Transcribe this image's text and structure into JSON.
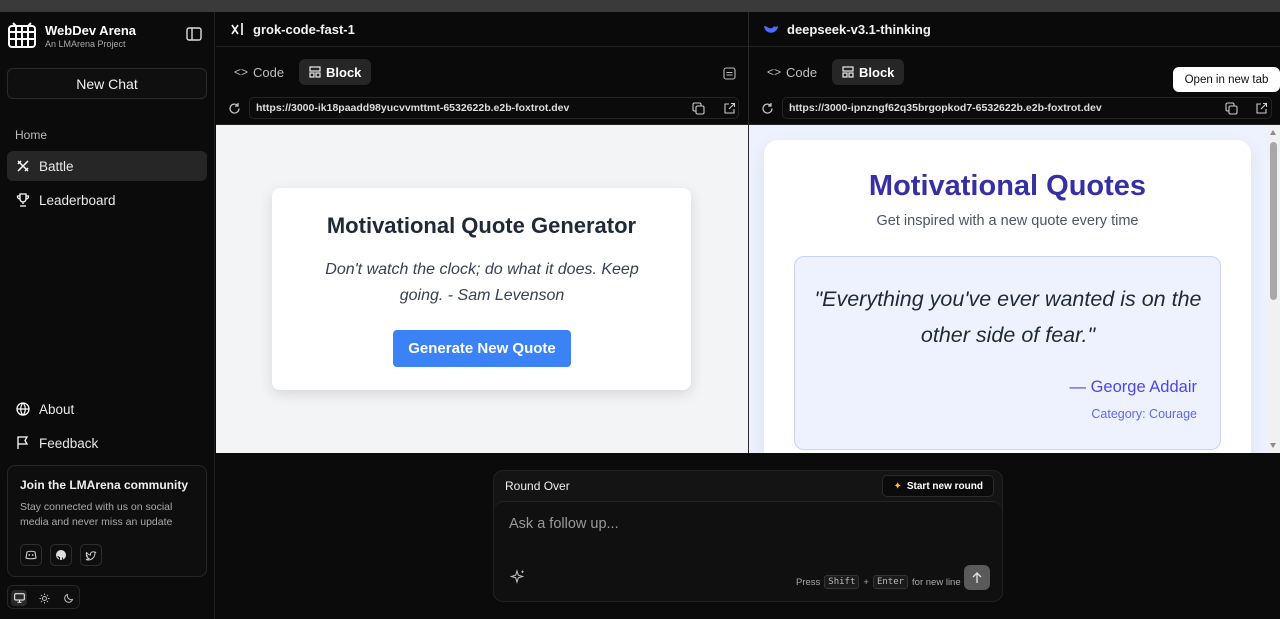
{
  "app": {
    "name": "WebDev Arena",
    "subtitle": "An LMArena Project"
  },
  "sidebar": {
    "new_chat": "New Chat",
    "home": "Home",
    "items": [
      {
        "label": "Battle",
        "icon": "swords-icon",
        "active": true
      },
      {
        "label": "Leaderboard",
        "icon": "trophy-icon",
        "active": false
      }
    ],
    "bottom_items": [
      {
        "label": "About",
        "icon": "globe-icon"
      },
      {
        "label": "Feedback",
        "icon": "flag-icon"
      }
    ],
    "community": {
      "title": "Join the LMArena community",
      "text": "Stay connected with us on social media and never miss an update"
    }
  },
  "left_pane": {
    "model": "grok-code-fast-1",
    "tabs": {
      "code": "Code",
      "block": "Block"
    },
    "url": "https://3000-ik18paadd98yucvvmttmt-6532622b.e2b-foxtrot.dev",
    "preview": {
      "title": "Motivational Quote Generator",
      "quote": "Don't watch the clock; do what it does. Keep going. - Sam Levenson",
      "button": "Generate New Quote"
    }
  },
  "right_pane": {
    "model": "deepseek-v3.1-thinking",
    "tabs": {
      "code": "Code",
      "block": "Block"
    },
    "url": "https://3000-ipnzngf62q35brgopkod7-6532622b.e2b-foxtrot.dev",
    "tooltip": "Open in new tab",
    "preview": {
      "title": "Motivational Quotes",
      "subtitle": "Get inspired with a new quote every time",
      "quote": "\"Everything you've ever wanted is on the other side of fear.\"",
      "author": "— George Addair",
      "category": "Category: Courage"
    }
  },
  "composer": {
    "status": "Round Over",
    "start_new": "Start new round",
    "placeholder": "Ask a follow up...",
    "hint_press": "Press",
    "hint_shift": "Shift",
    "hint_plus": "+",
    "hint_enter": "Enter",
    "hint_suffix": "for new line"
  },
  "colors": {
    "accent_blue": "#3b82f6",
    "indigo_title": "#3730a3",
    "indigo_text": "#4f46e5"
  }
}
